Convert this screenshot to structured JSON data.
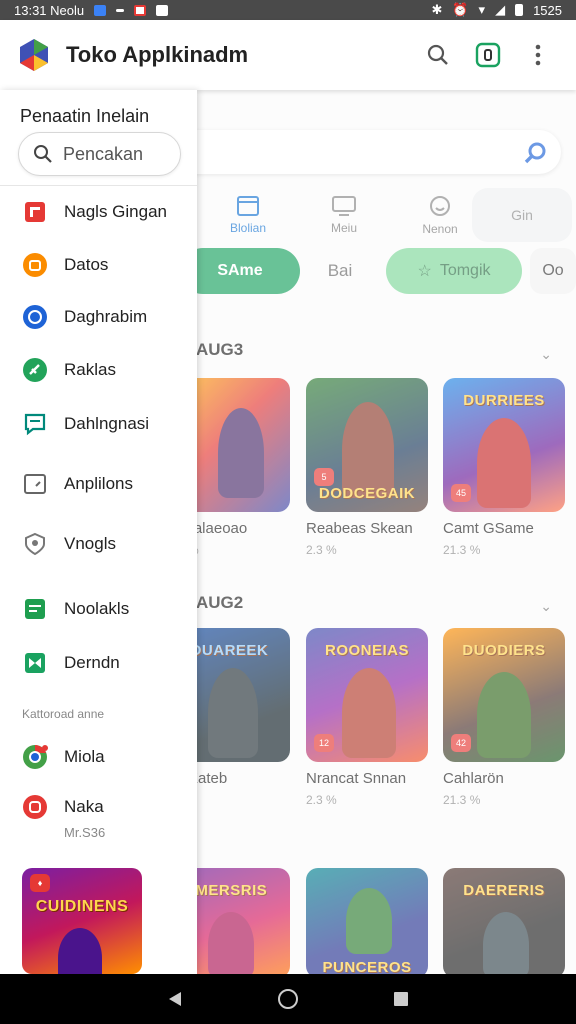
{
  "status_bar": {
    "left_text": "13:31 Neolu",
    "right_text": "1525"
  },
  "app_bar": {
    "title": "Toko Applkinadm"
  },
  "main": {
    "tabs": [
      {
        "label": "Blolian",
        "active": true
      },
      {
        "label": "Meiu"
      },
      {
        "label": "Nenon"
      }
    ],
    "tab_extra": "Gin",
    "chips": {
      "primary": "SAme",
      "secondary": "Bai",
      "tertiary": "Tomgik",
      "fourth": "Oo"
    },
    "sections": [
      {
        "title": "AUG3",
        "cards": [
          {
            "name": "Moralaeoao",
            "rating": "2.3 %",
            "art_title": "",
            "badge": "5"
          },
          {
            "name": "Reabeas Skean",
            "rating": "2.3 %",
            "art_title": "DODCEGAIK",
            "badge": "5"
          },
          {
            "name": "Camt GSame",
            "rating": "21.3 %",
            "art_title": "DURRIEES",
            "badge": "45"
          }
        ]
      },
      {
        "title": "AUG2",
        "cards": [
          {
            "name": "OoKateb",
            "rating": "2 %",
            "art_title": "OUAREEK",
            "badge": ""
          },
          {
            "name": "Nrancat Snnan",
            "rating": "2.3 %",
            "art_title": "ROONEIAS",
            "badge": "12"
          },
          {
            "name": "Cahlarön",
            "rating": "21.3 %",
            "art_title": "DUODIERS",
            "badge": "42"
          }
        ]
      },
      {
        "cards": [
          {
            "art_title": "IMERSRIS"
          },
          {
            "art_title": "PUNCEROS"
          },
          {
            "art_title": "DAERERIS"
          }
        ]
      }
    ]
  },
  "drawer": {
    "title": "Penaatin Inelain",
    "search_placeholder": "Pencakan",
    "items": [
      {
        "label": "Nagls Gingan",
        "icon": "square-app-icon",
        "color": "#e53935"
      },
      {
        "label": "Datos",
        "icon": "face-icon",
        "color": "#fb8c00"
      },
      {
        "label": "Daghrabim",
        "icon": "compass-icon",
        "color": "#1e63d6"
      },
      {
        "label": "Raklas",
        "icon": "leaf-icon",
        "color": "#22a35a"
      },
      {
        "label": "Dahlngnasi",
        "icon": "chat-icon",
        "color": "#00897b"
      },
      {
        "label": "Anplilons",
        "icon": "window-icon",
        "color": "#666666"
      },
      {
        "label": "Vnogls",
        "icon": "shield-icon",
        "color": "#777777"
      },
      {
        "label": "Noolakls",
        "icon": "list-icon",
        "color": "#1e9e4f"
      },
      {
        "label": "Derndn",
        "icon": "bowtie-icon",
        "color": "#1aa260"
      }
    ],
    "subheader": "Kattoroad anne",
    "extra_items": [
      {
        "label": "Miola",
        "icon": "chrome-icon"
      },
      {
        "label": "Naka",
        "icon": "red-app-icon",
        "meta": "Mr.S36"
      }
    ],
    "card_title": "CUIDINENS"
  }
}
